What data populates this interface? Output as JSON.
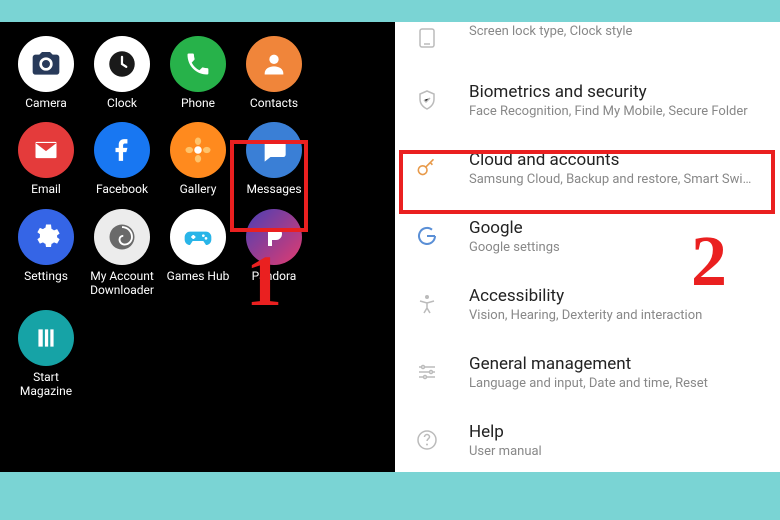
{
  "left": {
    "apps": [
      {
        "name": "camera",
        "label": "Camera"
      },
      {
        "name": "clock",
        "label": "Clock"
      },
      {
        "name": "phone",
        "label": "Phone"
      },
      {
        "name": "contacts",
        "label": "Contacts"
      },
      {
        "name": "email",
        "label": "Email"
      },
      {
        "name": "facebook",
        "label": "Facebook"
      },
      {
        "name": "gallery",
        "label": "Gallery"
      },
      {
        "name": "messages",
        "label": "Messages"
      },
      {
        "name": "settings",
        "label": "Settings"
      },
      {
        "name": "myaccount",
        "label": "My Account Downloader"
      },
      {
        "name": "gameshub",
        "label": "Games Hub"
      },
      {
        "name": "pandora",
        "label": "Pandora"
      },
      {
        "name": "startmag",
        "label": "Start Magazine"
      }
    ],
    "step_number": "1"
  },
  "right": {
    "items": [
      {
        "icon": "lockscreen",
        "title": "",
        "sub": "Screen lock type, Clock style",
        "partial": true
      },
      {
        "icon": "shield",
        "title": "Biometrics and security",
        "sub": "Face Recognition, Find My Mobile, Secure Folder"
      },
      {
        "icon": "key",
        "title": "Cloud and accounts",
        "sub": "Samsung Cloud, Backup and restore, Smart Swi…",
        "highlight": true
      },
      {
        "icon": "google",
        "title": "Google",
        "sub": "Google settings"
      },
      {
        "icon": "accessibility",
        "title": "Accessibility",
        "sub": "Vision, Hearing, Dexterity and interaction"
      },
      {
        "icon": "general",
        "title": "General management",
        "sub": "Language and input, Date and time, Reset"
      },
      {
        "icon": "help",
        "title": "Help",
        "sub": "User manual"
      }
    ],
    "step_number": "2"
  }
}
